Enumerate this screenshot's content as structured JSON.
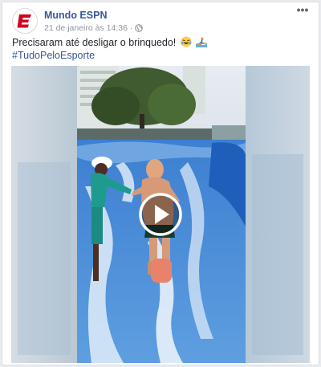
{
  "post": {
    "author": "Mundo ESPN",
    "timestamp": "21 de janeiro às 14:36",
    "separator": "·",
    "menu_label": "•••",
    "text": "Precisaram até desligar o brinquedo!",
    "hashtag": "#TudoPeloEsporte"
  },
  "icons": {
    "avatar": "espn-logo-icon",
    "audience": "globe-icon",
    "emoji_1": "laughing-emoji-icon",
    "emoji_2": "surfer-emoji-icon",
    "play": "play-icon"
  },
  "colors": {
    "brand_red": "#d2001f",
    "link_blue": "#365899",
    "water_blue": "#3d7fd1"
  }
}
